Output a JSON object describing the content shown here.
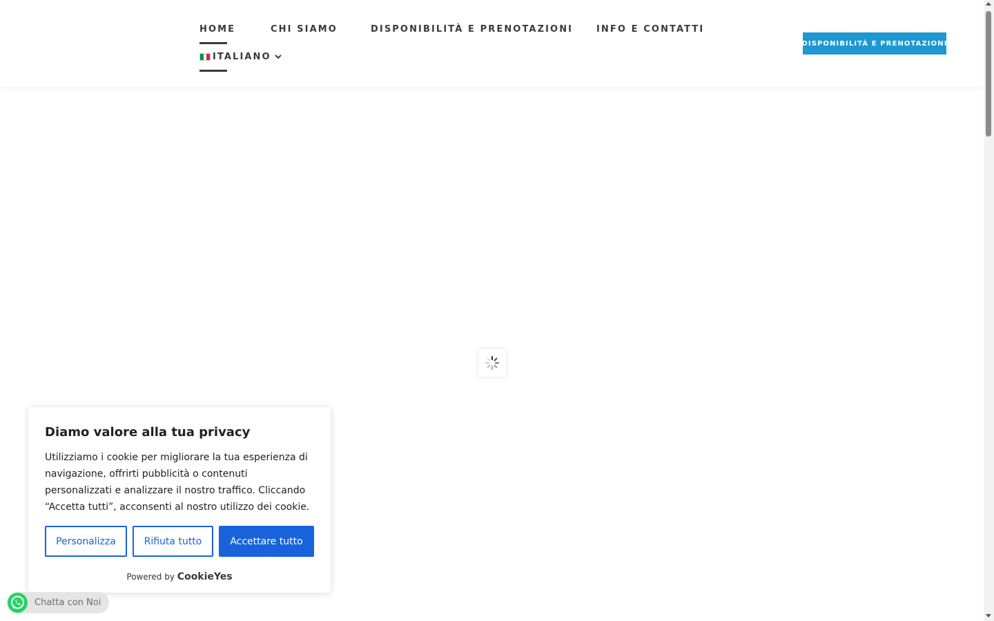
{
  "header": {
    "nav": [
      {
        "label": "HOME",
        "active": true
      },
      {
        "label": "CHI SIAMO",
        "active": false
      },
      {
        "label": "DISPONIBILITÀ E PRENOTAZIONI",
        "active": false
      },
      {
        "label": "INFO E CONTATTI",
        "active": false
      }
    ],
    "language": {
      "label": "ITALIANO",
      "flag": "italy-flag-icon"
    },
    "cta_label": "DISPONIBILITÀ E PRENOTAZIONI",
    "cta_color": "#1e98d0"
  },
  "main": {
    "loader_icon": "spinner-icon"
  },
  "cookie_banner": {
    "title": "Diamo valore alla tua privacy",
    "text": "Utilizziamo i cookie per migliorare la tua esperienza di navigazione, offrirti pubblicità o contenuti personalizzati e analizzare il nostro traffico. Cliccando “Accetta tutti”, acconsenti al nostro utilizzo dei cookie.",
    "buttons": {
      "customize": "Personalizza",
      "reject": "Rifiuta tutto",
      "accept": "Accettare tutto"
    },
    "powered_by": "Powered by",
    "brand": "CookieYes",
    "accent_color": "#1863dc"
  },
  "chat_widget": {
    "label": "Chatta con Noi",
    "icon": "whatsapp-icon",
    "color": "#25d366"
  }
}
